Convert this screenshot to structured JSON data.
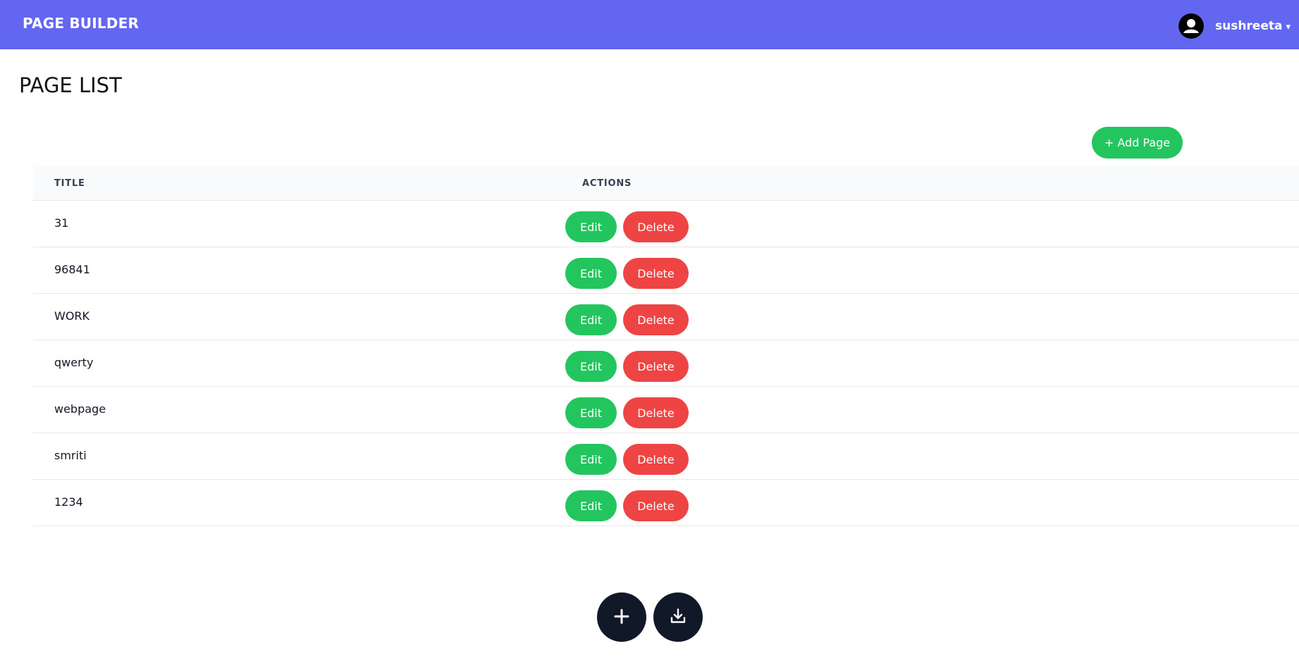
{
  "header": {
    "brand": "PAGE BUILDER",
    "user": {
      "name": "sushreeta",
      "caret": "▾",
      "avatar_icon": "user-avatar-icon"
    }
  },
  "main": {
    "title": "PAGE LIST",
    "add_page_label": "+ Add Page",
    "table": {
      "columns": [
        "TITLE",
        "ACTIONS"
      ],
      "rows": [
        {
          "title": "31",
          "edit": "Edit",
          "delete": "Delete"
        },
        {
          "title": "96841",
          "edit": "Edit",
          "delete": "Delete"
        },
        {
          "title": "WORK",
          "edit": "Edit",
          "delete": "Delete"
        },
        {
          "title": "qwerty",
          "edit": "Edit",
          "delete": "Delete"
        },
        {
          "title": "webpage",
          "edit": "Edit",
          "delete": "Delete"
        },
        {
          "title": "smriti",
          "edit": "Edit",
          "delete": "Delete"
        },
        {
          "title": "1234",
          "edit": "Edit",
          "delete": "Delete"
        }
      ]
    }
  },
  "fabs": [
    {
      "name": "add-fab-button",
      "icon": "plus-icon"
    },
    {
      "name": "download-fab-button",
      "icon": "download-icon"
    }
  ],
  "colors": {
    "header": "#6366f1",
    "success": "#22c55e",
    "danger": "#ef4444",
    "dark": "#111827"
  }
}
